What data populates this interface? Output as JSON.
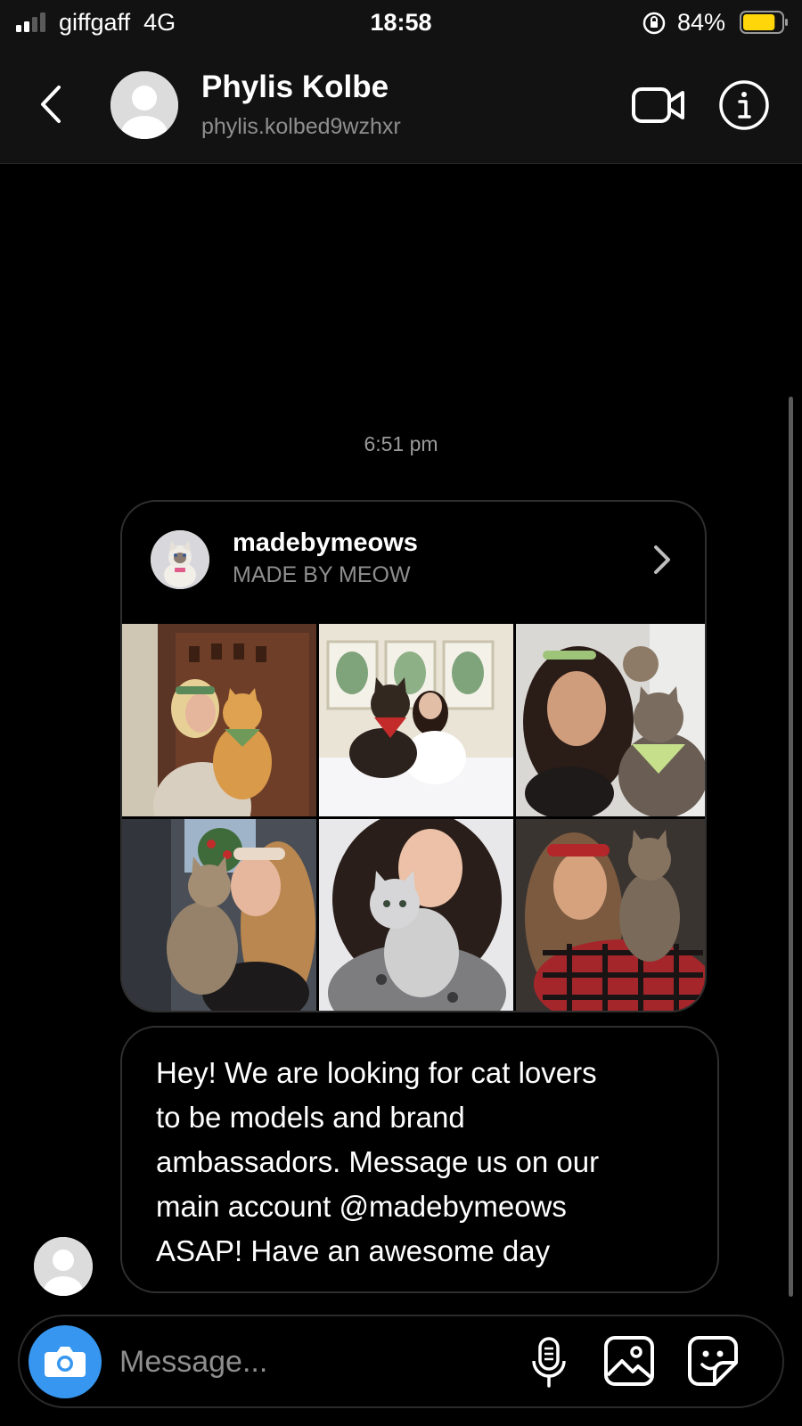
{
  "status_bar": {
    "carrier": "giffgaff",
    "network": "4G",
    "time": "18:58",
    "battery_percent": "84%",
    "battery_level": 0.84,
    "battery_color": "#ffd60a"
  },
  "header": {
    "name": "Phylis Kolbe",
    "username": "phylis.kolbed9wzhxr"
  },
  "thread": {
    "timestamp": "6:51 pm",
    "shared_profile": {
      "username": "madebymeows",
      "display_name": "MADE BY MEOW",
      "photos": [
        {
          "name": "photo-woman-kissing-orange-cat"
        },
        {
          "name": "photo-cat-with-red-bandana-on-bed"
        },
        {
          "name": "photo-woman-with-two-tabby-cats"
        },
        {
          "name": "photo-woman-holding-tabby-cat"
        },
        {
          "name": "photo-woman-holding-silver-tabby"
        },
        {
          "name": "photo-woman-in-plaid-with-cat"
        }
      ]
    },
    "message": {
      "lines": [
        "Hey! We are looking for cat lovers",
        "to be models and brand",
        "ambassadors. Message us on our",
        "main account @madebymeows",
        "ASAP! Have an awesome day"
      ]
    }
  },
  "composer": {
    "placeholder": "Message..."
  },
  "colors": {
    "accent": "#3797f0",
    "background": "#000000",
    "header_bg": "#121212",
    "secondary_text": "#8e8e8e"
  },
  "icons": [
    "signal-icon",
    "orientation-lock-icon",
    "battery-icon",
    "back-chevron-icon",
    "video-call-icon",
    "info-icon",
    "chevron-right-icon",
    "camera-icon",
    "microphone-icon",
    "gallery-icon",
    "sticker-icon"
  ]
}
